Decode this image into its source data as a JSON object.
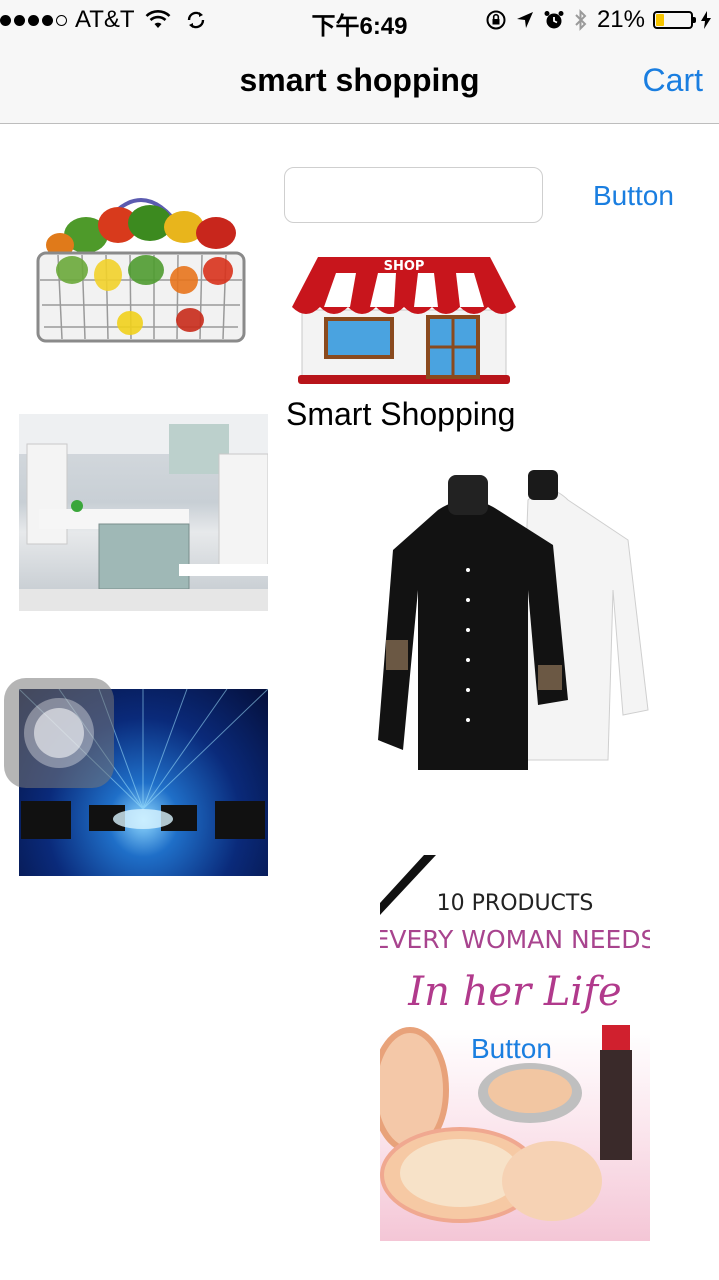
{
  "status_bar": {
    "carrier": "AT&T",
    "time": "下午6:49",
    "battery": "21%",
    "icons": [
      "signal-dots",
      "wifi-icon",
      "sync-icon",
      "rotation-lock-icon",
      "location-icon",
      "alarm-icon",
      "bluetooth-icon",
      "charging-icon"
    ]
  },
  "nav": {
    "title": "smart shopping",
    "cart_label": "Cart"
  },
  "search": {
    "value": "",
    "placeholder": ""
  },
  "buttons": {
    "top_button": "Button",
    "overlay_button": "Button"
  },
  "store": {
    "sign": "SHOP",
    "label": "Smart Shopping"
  },
  "cosmetics_ad": {
    "line1": "10 PRODUCTS",
    "line2": "EVERY WOMAN NEEDS",
    "line3": "In her Life"
  },
  "colors": {
    "accent": "#1a7ee0",
    "battery": "#f5c400"
  }
}
